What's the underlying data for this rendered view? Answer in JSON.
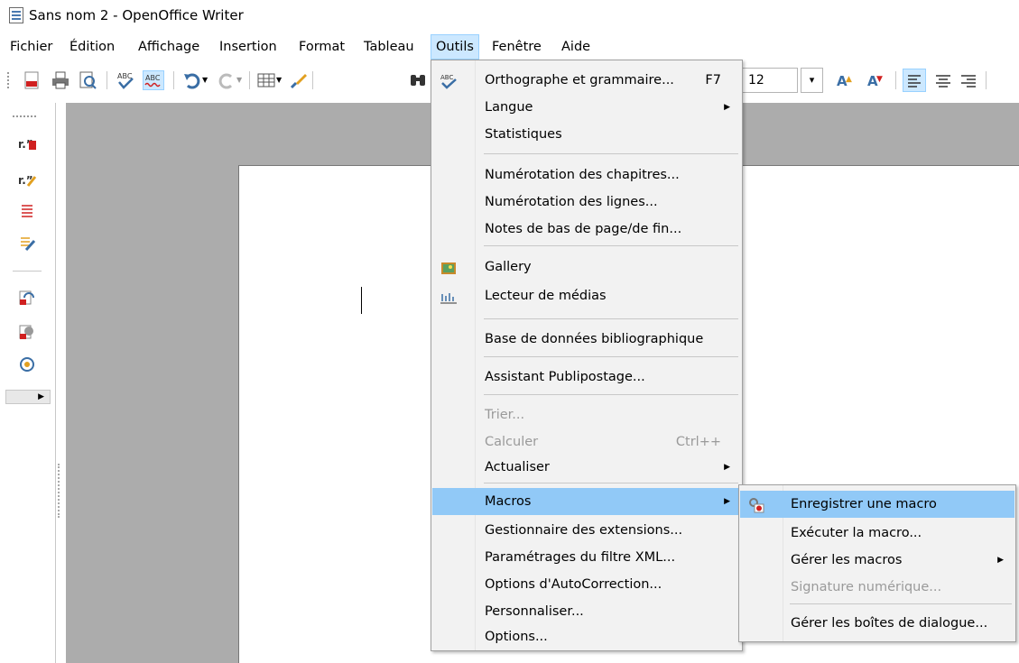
{
  "window": {
    "title": "Sans nom 2 - OpenOffice Writer"
  },
  "menubar": {
    "items": [
      {
        "label": "Fichier"
      },
      {
        "label": "Édition"
      },
      {
        "label": "Affichage"
      },
      {
        "label": "Insertion"
      },
      {
        "label": "Format"
      },
      {
        "label": "Tableau"
      },
      {
        "label": "Outils",
        "active": true
      },
      {
        "label": "Fenêtre"
      },
      {
        "label": "Aide"
      }
    ]
  },
  "toolbar": {
    "font_size": "12",
    "icons": [
      "export-pdf-icon",
      "print-icon",
      "print-preview-icon",
      "spellcheck-icon",
      "autospellcheck-icon",
      "undo-icon",
      "redo-icon",
      "table-icon",
      "draw-icon",
      "find-icon"
    ],
    "format_icons": [
      "grow-font-icon",
      "shrink-font-icon",
      "align-left-icon",
      "align-center-icon",
      "align-right-icon"
    ]
  },
  "outils_menu": {
    "items": [
      {
        "label": "Orthographe et grammaire...",
        "shortcut": "F7",
        "icon": "spellcheck-icon"
      },
      {
        "label": "Langue",
        "submenu": true
      },
      {
        "label": "Statistiques"
      },
      {
        "label": "Numérotation des chapitres..."
      },
      {
        "label": "Numérotation des lignes..."
      },
      {
        "label": "Notes de bas de page/de fin..."
      },
      {
        "label": "Gallery",
        "icon": "gallery-icon"
      },
      {
        "label": "Lecteur de médias",
        "icon": "media-player-icon"
      },
      {
        "label": "Base de données bibliographique"
      },
      {
        "label": "Assistant Publipostage..."
      },
      {
        "label": "Trier...",
        "disabled": true
      },
      {
        "label": "Calculer",
        "shortcut": "Ctrl++",
        "disabled": true
      },
      {
        "label": "Actualiser",
        "submenu": true
      },
      {
        "label": "Macros",
        "submenu": true,
        "highlighted": true
      },
      {
        "label": "Gestionnaire des extensions..."
      },
      {
        "label": "Paramétrages du filtre XML..."
      },
      {
        "label": "Options d'AutoCorrection..."
      },
      {
        "label": "Personnaliser..."
      },
      {
        "label": "Options..."
      }
    ]
  },
  "macros_submenu": {
    "items": [
      {
        "label": "Enregistrer une macro",
        "highlighted": true,
        "icon": "record-macro-icon"
      },
      {
        "label": "Exécuter la macro..."
      },
      {
        "label": "Gérer les macros",
        "submenu": true
      },
      {
        "label": "Signature numérique...",
        "disabled": true
      },
      {
        "label": "Gérer les boîtes de dialogue..."
      }
    ]
  },
  "colors": {
    "menu_highlight": "#91c9f7",
    "menubar_active": "#cce8ff",
    "doc_background": "#acacac",
    "disabled_text": "#9a9a9a"
  }
}
